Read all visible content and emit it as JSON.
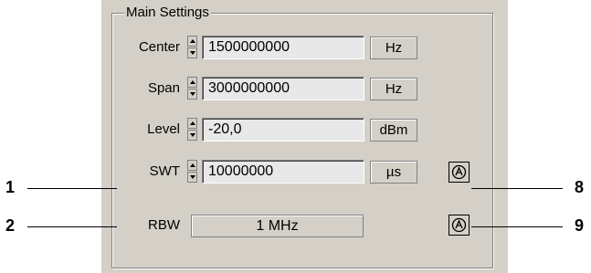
{
  "group": {
    "title": "Main Settings"
  },
  "rows": [
    {
      "label": "Center",
      "value": "1500000000",
      "unit": "Hz"
    },
    {
      "label": "Span",
      "value": "3000000000",
      "unit": "Hz"
    },
    {
      "label": "Level",
      "value": "-20,0",
      "unit": "dBm"
    },
    {
      "label": "SWT",
      "value": "10000000",
      "unit": "µs"
    }
  ],
  "rbw": {
    "label": "RBW",
    "value": "1 MHz"
  },
  "callouts": {
    "left": [
      "1",
      "2"
    ],
    "right": [
      "8",
      "9"
    ]
  },
  "icons": {
    "auto": "auto-mode-icon",
    "spin": "spin-arrows-icon"
  }
}
